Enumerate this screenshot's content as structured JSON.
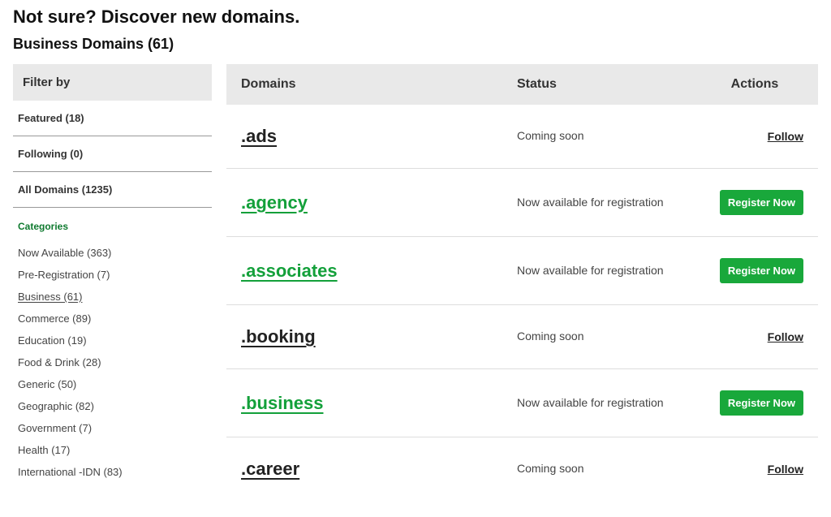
{
  "hero": {
    "title": "Not sure? Discover new domains."
  },
  "section": {
    "title": "Business  Domains  (61)"
  },
  "sidebar": {
    "filter_label": "Filter by",
    "primary": [
      {
        "label": "Featured (18)"
      },
      {
        "label": "Following (0)"
      },
      {
        "label": "All Domains (1235)"
      }
    ],
    "categories_label": "Categories",
    "categories": [
      {
        "label": "Now Available (363)",
        "active": false
      },
      {
        "label": "Pre-Registration (7)",
        "active": false
      },
      {
        "label": "Business (61)",
        "active": true
      },
      {
        "label": "Commerce (89)",
        "active": false
      },
      {
        "label": "Education (19)",
        "active": false
      },
      {
        "label": "Food & Drink (28)",
        "active": false
      },
      {
        "label": "Generic (50)",
        "active": false
      },
      {
        "label": "Geographic (82)",
        "active": false
      },
      {
        "label": "Government (7)",
        "active": false
      },
      {
        "label": "Health (17)",
        "active": false
      },
      {
        "label": "International -IDN (83)",
        "active": false
      }
    ]
  },
  "table": {
    "headers": {
      "domains": "Domains",
      "status": "Status",
      "actions": "Actions"
    },
    "labels": {
      "register": "Register Now",
      "follow": "Follow"
    },
    "rows": [
      {
        "name": ".ads",
        "status": "Coming soon",
        "action": "follow"
      },
      {
        "name": ".agency",
        "status": "Now available for registration",
        "action": "register"
      },
      {
        "name": ".associates",
        "status": "Now available for registration",
        "action": "register"
      },
      {
        "name": ".booking",
        "status": "Coming soon",
        "action": "follow"
      },
      {
        "name": ".business",
        "status": "Now available for registration",
        "action": "register"
      },
      {
        "name": ".career",
        "status": "Coming soon",
        "action": "follow"
      }
    ]
  }
}
